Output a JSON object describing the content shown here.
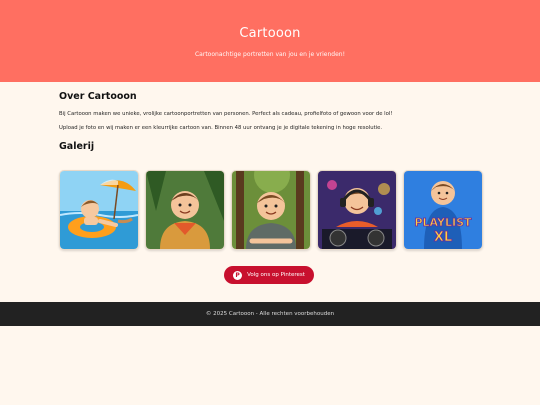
{
  "header": {
    "title": "Cartooon",
    "tagline": "Cartoonachtige portretten van jou en je vrienden!",
    "bg_color": "#ff6f61"
  },
  "about": {
    "title": "Over Cartooon",
    "paragraph1": "Bij Cartooon maken we unieke, vrolijke cartoonportretten van personen. Perfect als cadeau, profielfoto of gewoon voor de lol!",
    "paragraph2": "Upload je foto en wij maken er een kleurrijke cartoon van. Binnen 48 uur ontvang je je digitale tekening in hoge resolutie."
  },
  "gallery": {
    "title": "Galerij",
    "items": [
      {
        "name": "beach-float-cartoon"
      },
      {
        "name": "scout-cartoon"
      },
      {
        "name": "forest-boy-cartoon"
      },
      {
        "name": "dj-cartoon"
      },
      {
        "name": "playlist-xl-cartoon",
        "text_line1": "PLAYLIST",
        "text_line2": "XL"
      }
    ]
  },
  "pinterest": {
    "label": "Volg ons op Pinterest",
    "icon": "pinterest-icon",
    "color": "#c8102e"
  },
  "footer": {
    "text": "© 2025 Cartooon - Alle rechten voorbehouden"
  }
}
